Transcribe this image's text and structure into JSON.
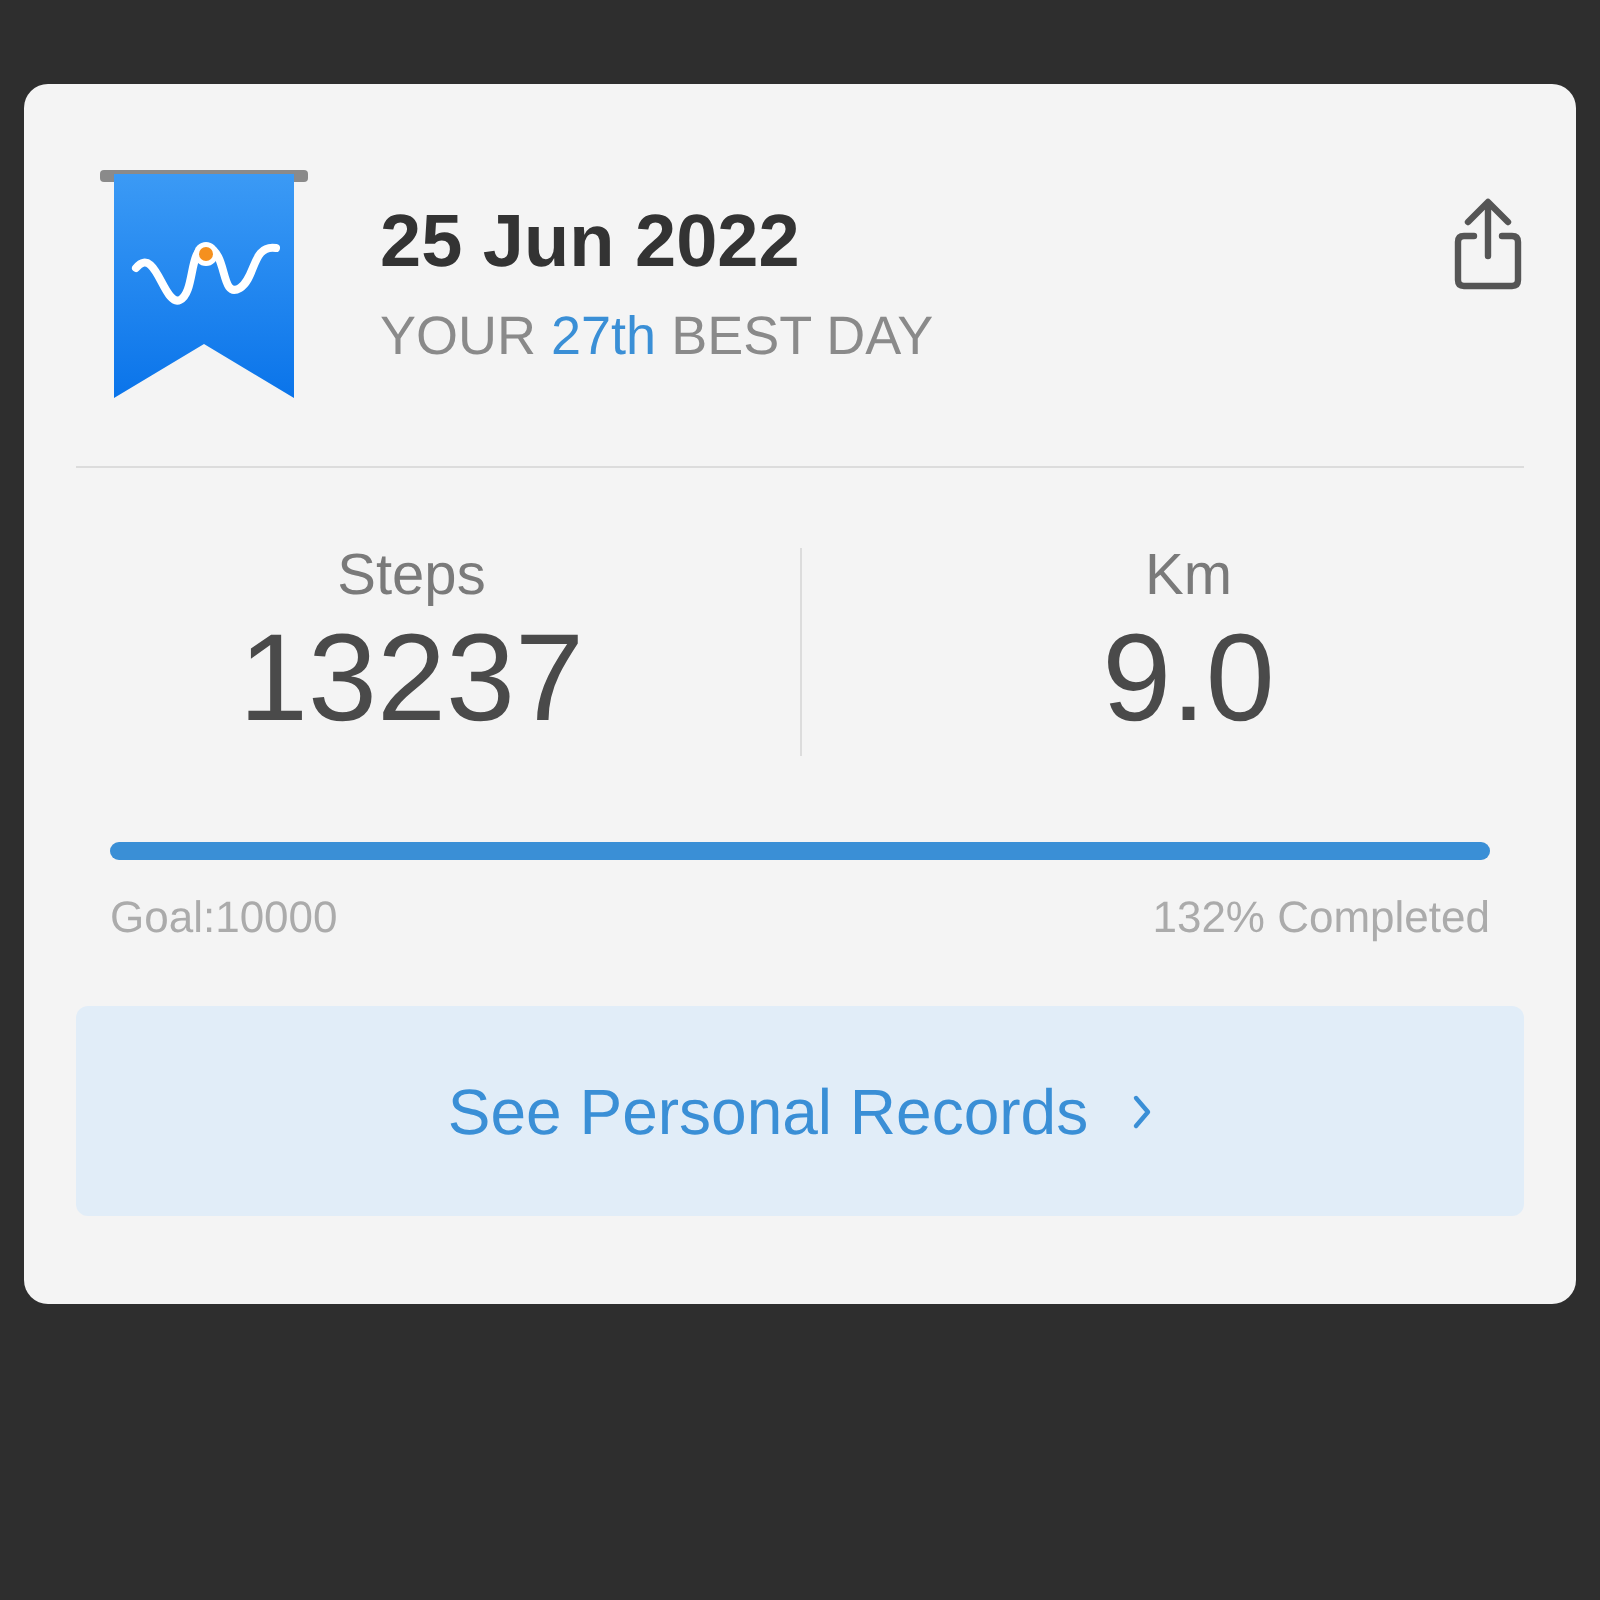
{
  "header": {
    "date": "25 Jun 2022",
    "rank_before": "YOUR",
    "rank": "27th",
    "rank_after": "BEST DAY"
  },
  "stats": [
    {
      "label": "Steps",
      "value": "13237"
    },
    {
      "label": "Km",
      "value": "9.0"
    }
  ],
  "progress": {
    "level": 1.0,
    "goal": "Goal:10000",
    "completed": "132% Completed"
  },
  "records_button": {
    "label": "See Personal Records"
  }
}
